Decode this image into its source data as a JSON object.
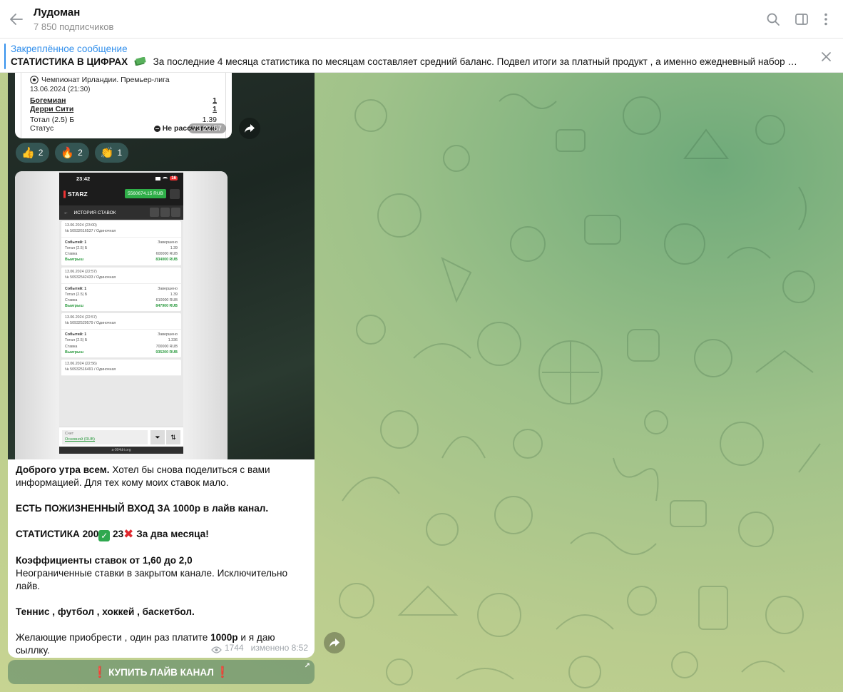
{
  "header": {
    "title": "Лудоман",
    "subscribers": "7 850 подписчиков"
  },
  "pinned": {
    "label": "Закреплённое сообщение",
    "bold": "СТАТИСТИКА В ЦИФРАХ",
    "text": "За последние 4 месяца статистика по месяцам составляет средний баланс. Подвел итоги за платный продукт , а именно ежедневный набор на пла..."
  },
  "bet_card": {
    "league": "Чемпионат Ирландии. Премьер-лига",
    "date": "13.06.2024 (21:30)",
    "team1": "Богемиан",
    "team1_score": "1",
    "team2": "Дерри Сити",
    "team2_score": "1",
    "total_label": "Тотал (2.5) Б",
    "total_value": "1.39",
    "status_label": "Статус",
    "status_value": "Не рассчитано",
    "views": "73 22:57"
  },
  "reactions": [
    {
      "emoji": "👍",
      "count": "2"
    },
    {
      "emoji": "🔥",
      "count": "2"
    },
    {
      "emoji": "👏",
      "count": "1"
    }
  ],
  "phone": {
    "time": "23:42",
    "battery": "16",
    "brand": "STARZ",
    "balance": "5560674.15 RUB",
    "nav_title": "ИСТОРИЯ СТАВОК",
    "account_label": "Счет",
    "account_value": "Основной (RUB)",
    "footer": "a-904dri.org",
    "bets": [
      {
        "date": "13.06.2024 (23:00)",
        "id": "№ 50932616537 / Одиночная",
        "events": "Событий: 1",
        "state": "Завершено",
        "total": "Тотал (2.5) Б",
        "coef": "1.39",
        "stake_label": "Ставка",
        "stake": "600000 RUB",
        "result": "Выигрыш",
        "win": "834000 RUB"
      },
      {
        "date": "13.06.2024 (22:57)",
        "id": "№ 50932542433 / Одиночная",
        "events": "Событий: 1",
        "state": "Завершено",
        "total": "Тотал (2.5) Б",
        "coef": "1.39",
        "stake_label": "Ставка",
        "stake": "610000 RUB",
        "result": "Выигрыш",
        "win": "847900 RUB"
      },
      {
        "date": "13.06.2024 (22:57)",
        "id": "№ 50932529579 / Одиночная",
        "events": "Событий: 1",
        "state": "Завершено",
        "total": "Тотал (2.5) Б",
        "coef": "1.336",
        "stake_label": "Ставка",
        "stake": "700000 RUB",
        "result": "Выигрыш",
        "win": "935200 RUB"
      },
      {
        "date": "13.06.2024 (22:56)",
        "id": "№ 50932516491 / Одиночная",
        "events": "",
        "state": "",
        "total": "",
        "coef": "",
        "stake_label": "",
        "stake": "",
        "result": "",
        "win": ""
      }
    ]
  },
  "message": {
    "greeting_bold": "Доброго утра всем.",
    "greeting_rest": " Хотел бы снова поделиться с вами информацией. Для тех кому моих ставок мало.",
    "lifetime": "ЕСТЬ ПОЖИЗНЕННЫЙ ВХОД ЗА 1000р в лайв канал.",
    "stats_prefix": "СТАТИСТИКА 200",
    "stats_mid": " 23",
    "stats_suffix": " За два месяца!",
    "coef_bold": "Коэффициенты ставок от 1,60 до 2,0",
    "unlimited": "Неограниченные ставки в закрытом канале. Исключительно лайв.",
    "sports": "Теннис , футбол , хоккей , баскетбол.",
    "buy_pre": "Желающие приобрести , один раз платите ",
    "buy_bold": "1000р",
    "buy_post": " и я даю сыллку.",
    "views": "1744",
    "edited": "изменено 8:52"
  },
  "button": {
    "label": "КУПИТЬ ЛАЙВ КАНАЛ"
  },
  "colors": {
    "accent": "#3390ec",
    "win_green": "#2a9a3e",
    "cross_red": "#e0272e"
  }
}
